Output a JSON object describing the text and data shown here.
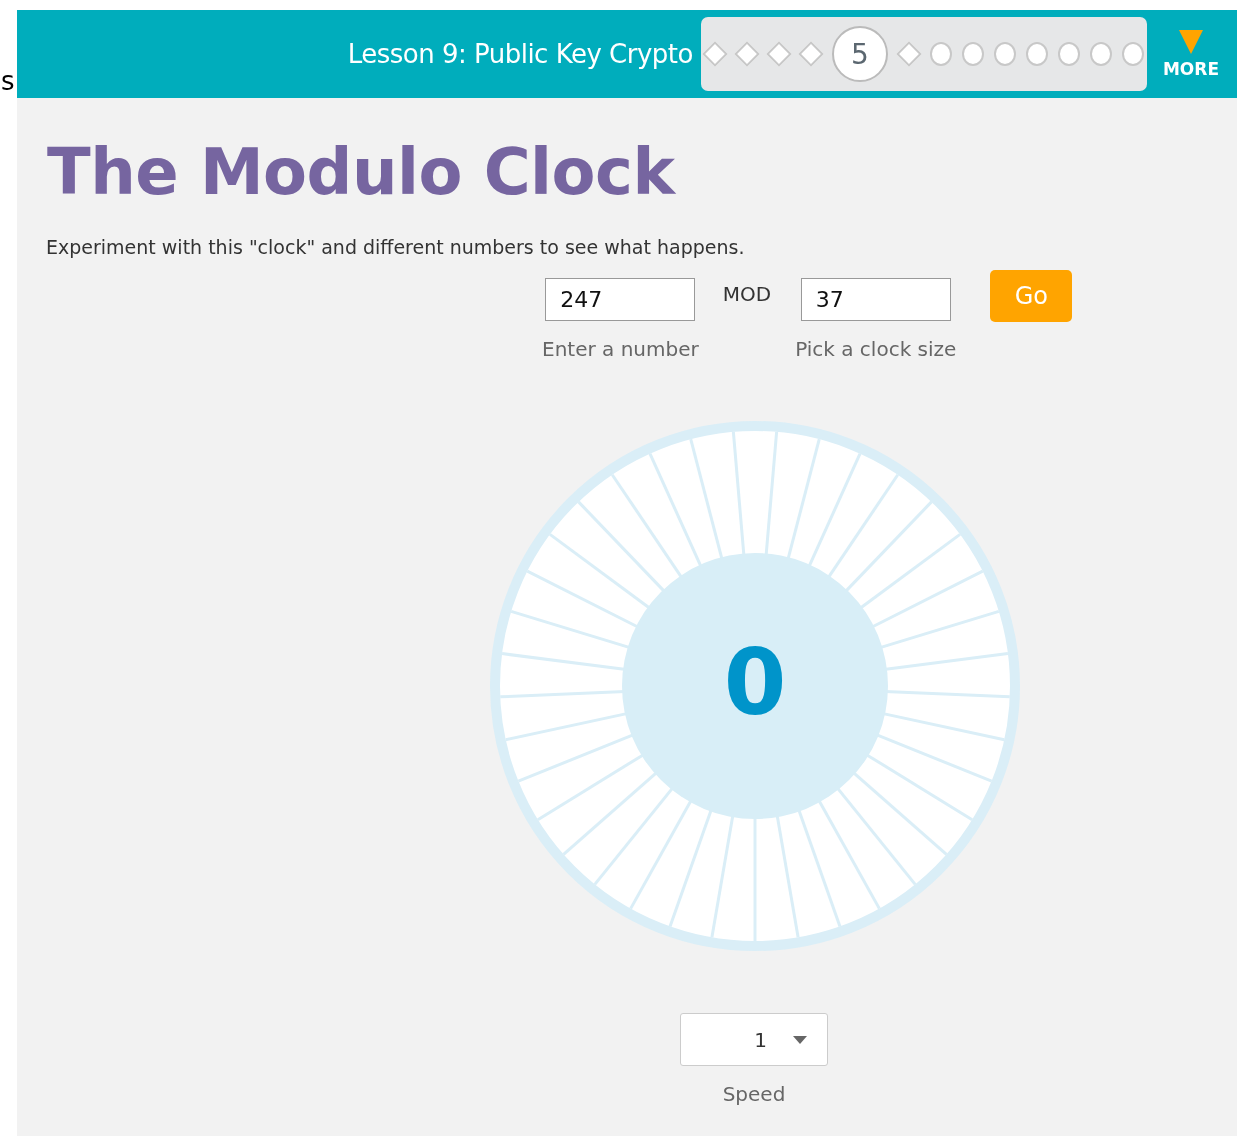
{
  "edge_text": "s",
  "header": {
    "lesson_title": "Lesson 9: Public Key Crypto",
    "more_label": "MORE",
    "progress": [
      {
        "kind": "diamond",
        "selected": false
      },
      {
        "kind": "diamond",
        "selected": false
      },
      {
        "kind": "diamond",
        "selected": false
      },
      {
        "kind": "diamond",
        "selected": false
      },
      {
        "kind": "numbered",
        "label": "5",
        "selected": true
      },
      {
        "kind": "diamond",
        "selected": false
      },
      {
        "kind": "circle",
        "selected": false
      },
      {
        "kind": "circle",
        "selected": false
      },
      {
        "kind": "circle",
        "selected": false
      },
      {
        "kind": "circle",
        "selected": false
      },
      {
        "kind": "circle",
        "selected": false
      },
      {
        "kind": "circle",
        "selected": false
      },
      {
        "kind": "circle",
        "selected": false
      }
    ]
  },
  "title": "The Modulo Clock",
  "description": "Experiment with this \"clock\" and different numbers to see what happens.",
  "number_field": {
    "value": "247",
    "caption": "Enter a number"
  },
  "mod_label": "MOD",
  "size_field": {
    "value": "37",
    "caption": "Pick a clock size"
  },
  "go_button": "Go",
  "clock": {
    "result": "0"
  },
  "speed": {
    "value": "1",
    "caption": "Speed"
  }
}
